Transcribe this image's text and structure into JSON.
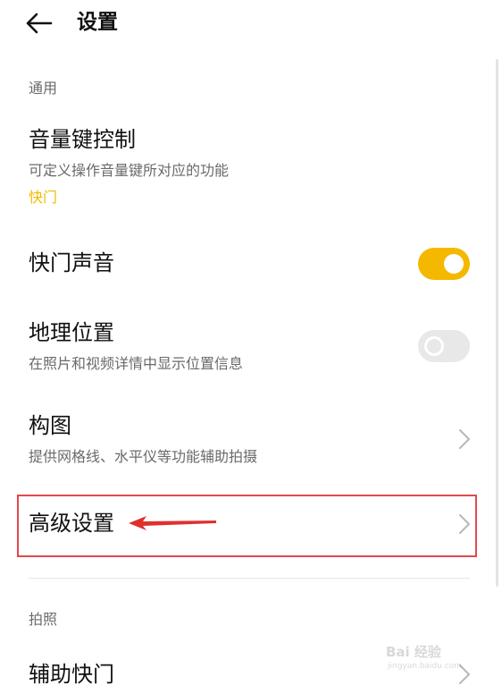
{
  "header": {
    "title": "设置",
    "back_icon": "arrow-left-icon"
  },
  "colors": {
    "accent": "#f5b800",
    "highlight_border": "#e2484f",
    "annotation_arrow": "#e0302e",
    "toggle_off": "#e8e8e8"
  },
  "sections": {
    "general": {
      "label": "通用"
    },
    "photo": {
      "label": "拍照"
    }
  },
  "items": {
    "volume_key": {
      "title": "音量键控制",
      "subtitle": "可定义操作音量键所对应的功能",
      "value": "快门"
    },
    "shutter_sound": {
      "title": "快门声音",
      "toggle_on": true
    },
    "location": {
      "title": "地理位置",
      "subtitle": "在照片和视频详情中显示位置信息",
      "toggle_on": false
    },
    "composition": {
      "title": "构图",
      "subtitle": "提供网格线、水平仪等功能辅助拍摄",
      "icon": "chevron-right-icon"
    },
    "advanced": {
      "title": "高级设置",
      "icon": "chevron-right-icon"
    },
    "assist_shutter": {
      "title": "辅助快门",
      "icon": "chevron-right-icon"
    }
  },
  "watermark": {
    "text": "Bai 经验",
    "sub": "jingyan.baidu.com"
  }
}
